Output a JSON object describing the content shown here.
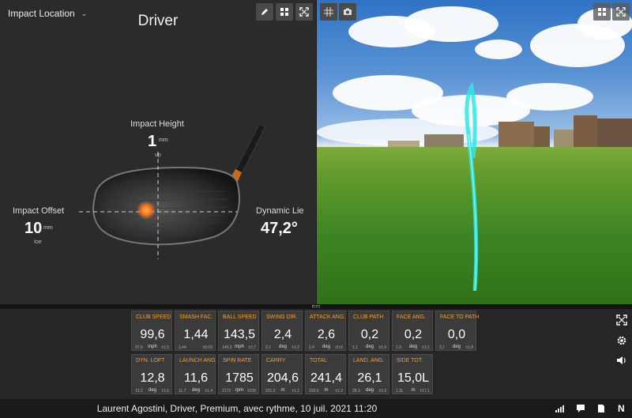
{
  "impact_panel": {
    "dropdown_label": "Impact Location",
    "club_title": "Driver",
    "impact_height": {
      "label": "Impact Height",
      "value": "1",
      "unit": "mm",
      "direction": "up"
    },
    "impact_offset": {
      "label": "Impact Offset",
      "value": "10",
      "unit": "mm",
      "direction": "toe"
    },
    "dynamic_lie": {
      "label": "Dynamic Lie",
      "value": "47,2°"
    }
  },
  "toolbar_icons": [
    "pencil-icon",
    "grid-layout-icon",
    "expand-icon",
    "grid-overlay-icon",
    "camera-icon"
  ],
  "colors": {
    "accent_orange": "#f0a030",
    "trajectory": "#2ee6e6",
    "impact_dot": "#ff7a1a"
  },
  "metrics": [
    {
      "label": "CLUB SPEED",
      "value": "99,6",
      "min": "97,6",
      "unit": "mph",
      "dev": "±1,5"
    },
    {
      "label": "SMASH FAC.",
      "value": "1,44",
      "min": "1,44",
      "unit": "",
      "dev": "±0,03"
    },
    {
      "label": "BALL SPEED",
      "value": "143,5",
      "min": "140,3",
      "unit": "mph",
      "dev": "±2,7"
    },
    {
      "label": "SWING DIR.",
      "value": "2,4",
      "min": "2,1",
      "unit": "deg",
      "dev": "±1,2"
    },
    {
      "label": "ATTACK ANG.",
      "value": "2,6",
      "min": "2,4",
      "unit": "deg",
      "dev": "±0,6"
    },
    {
      "label": "CLUB PATH",
      "value": "0,2",
      "min": "1,1",
      "unit": "deg",
      "dev": "±0,9"
    },
    {
      "label": "FACE ANG.",
      "value": "0,2",
      "min": "1,3",
      "unit": "deg",
      "dev": "±2,1"
    },
    {
      "label": "FACE TO PATH",
      "value": "0,0",
      "min": "2,1",
      "unit": "deg",
      "dev": "±1,8"
    },
    {
      "label": "DYN. LOFT",
      "value": "12,8",
      "min": "13,2",
      "unit": "deg",
      "dev": "±1,5"
    },
    {
      "label": "LAUNCH ANG.",
      "value": "11,6",
      "min": "11,7",
      "unit": "deg",
      "dev": "±1,4"
    },
    {
      "label": "SPIN RATE",
      "value": "1785",
      "min": "2172",
      "unit": "rpm",
      "dev": "±235"
    },
    {
      "label": "CARRY",
      "value": "204,6",
      "min": "201,2",
      "unit": "m",
      "dev": "±1,2"
    },
    {
      "label": "TOTAL",
      "value": "241,4",
      "min": "233,0",
      "unit": "m",
      "dev": "±1,3"
    },
    {
      "label": "LAND. ANG.",
      "value": "26,1",
      "min": "28,3",
      "unit": "deg",
      "dev": "±3,9"
    },
    {
      "label": "SIDE TOT.",
      "value": "15,0L",
      "min": "1,3L",
      "unit": "m",
      "dev": "±17,1"
    }
  ],
  "status_bar": {
    "text": "Laurent Agostini, Driver, Premium, avec rythme, 10 juil. 2021 11:20",
    "n_label": "N"
  }
}
